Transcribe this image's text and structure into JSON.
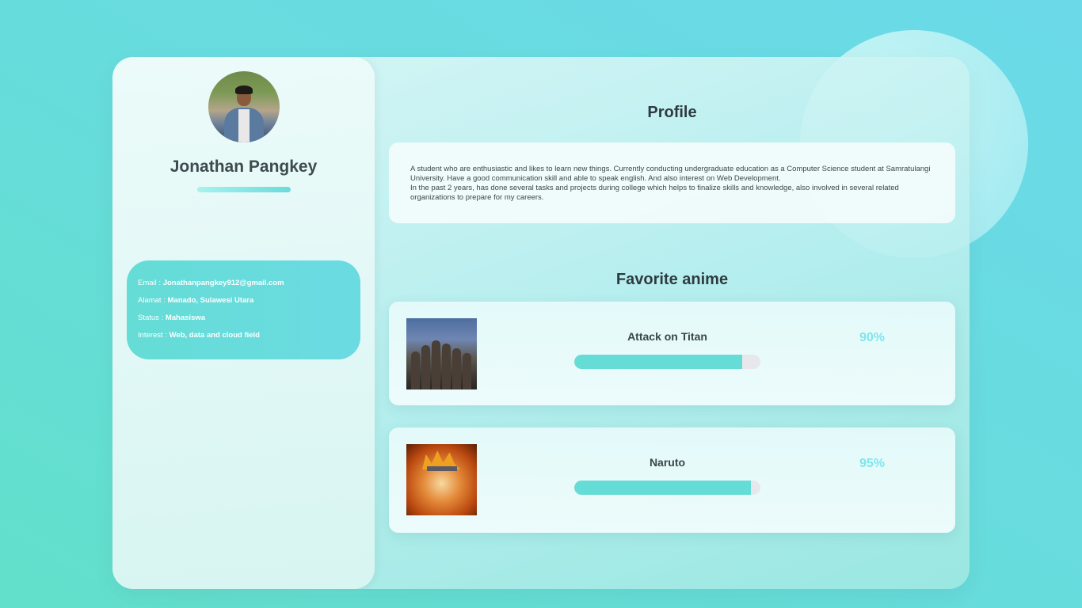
{
  "sidebar": {
    "name": "Jonathan Pangkey",
    "info": [
      {
        "label": "Email : ",
        "value": "Jonathanpangkey912@gmail.com"
      },
      {
        "label": "Alamat : ",
        "value": "Manado, Sulawesi Utara"
      },
      {
        "label": "Status : ",
        "value": "Mahasiswa"
      },
      {
        "label": "Interest : ",
        "value": "Web, data and cloud field"
      }
    ]
  },
  "profile": {
    "title": "Profile",
    "text": "A student who are enthusiastic and likes to learn new things. Currently conducting undergraduate education as a Computer Science student at Samratulangi University. Have a good communication skill and able to speak english. And also interest on Web Development.\nIn the past 2 years, has done several tasks and projects during college which helps to finalize skills and knowledge, also involved in several related organizations to prepare for my careers."
  },
  "anime": {
    "title": "Favorite anime",
    "items": [
      {
        "name": "Attack on Titan",
        "percent": 90,
        "percent_label": "90%"
      },
      {
        "name": "Naruto",
        "percent": 95,
        "percent_label": "95%"
      }
    ]
  },
  "colors": {
    "accent": "#66dcd6",
    "percent_text": "#7fe6ec",
    "title_text": "#2e3b40"
  }
}
